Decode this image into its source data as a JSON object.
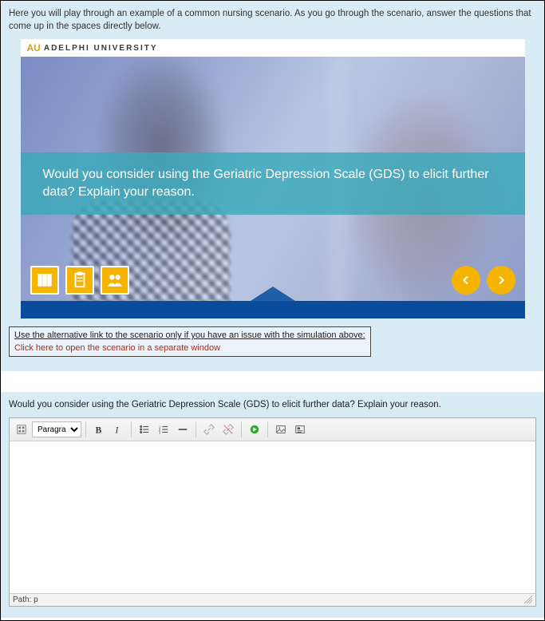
{
  "intro": {
    "text": "Here you will play through an example of a common nursing scenario.  As you go through the scenario, answer the questions that come up in the spaces directly below."
  },
  "brand": {
    "logo_mark": "AU",
    "name": "ADELPHI UNIVERSITY"
  },
  "scenario": {
    "question_text": "Would you consider using the Geriatric Depression Scale (GDS) to elicit further data? Explain your reason."
  },
  "icons": {
    "books": "books-icon",
    "clipboard": "clipboard-icon",
    "people": "people-icon"
  },
  "alt_box": {
    "title": "Use the alternative link to the scenario only if you have an issue with the simulation above:",
    "link_text": "Click here to open the scenario in a separate window"
  },
  "answer": {
    "prompt": "Would you consider using the Geriatric Depression Scale (GDS) to elicit further data?  Explain your reason."
  },
  "editor": {
    "format_options": [
      "Paragraph"
    ],
    "selected_format": "Paragraph",
    "path_label": "Path: p"
  }
}
